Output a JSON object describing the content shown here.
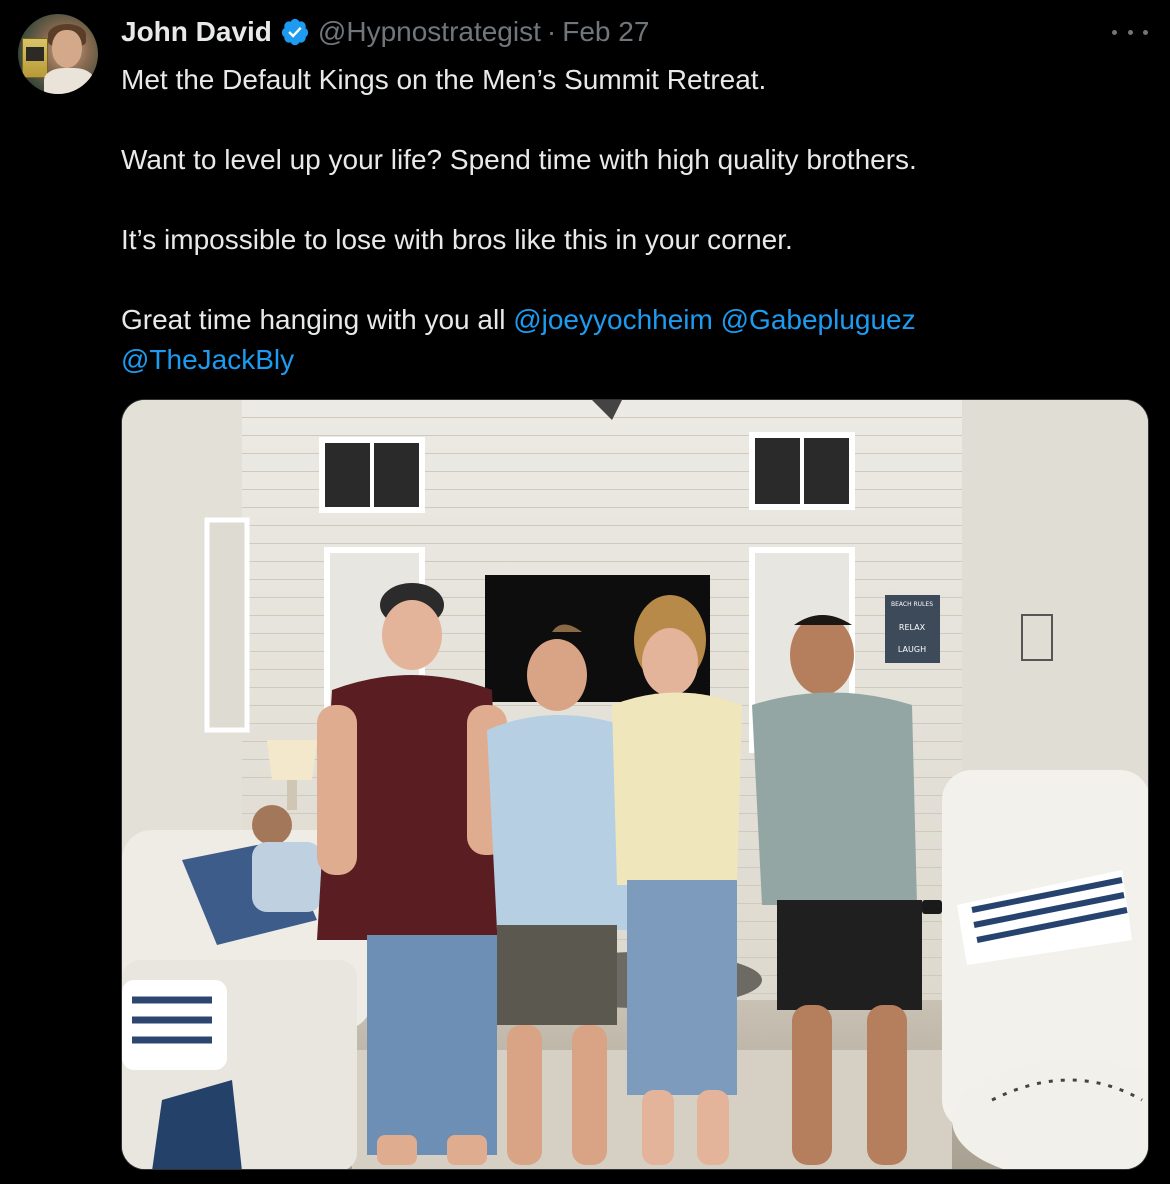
{
  "tweet": {
    "author_name": "John David",
    "author_handle": "@Hypnostrategist",
    "separator": "·",
    "date": "Feb 27",
    "lines": [
      "Met the Default Kings on the Men’s Summit Retreat.",
      "Want to level up your life? Spend time with high quality brothers.",
      "It’s impossible to lose with bros like this in your corner.",
      "Great time hanging with you all"
    ],
    "mentions": [
      "@joeyyochheim",
      "@Gabepluguez",
      "@TheJackBly"
    ]
  },
  "photo_sign": {
    "lines": [
      "BEACH RULES",
      "WATCH THE SUNRISE",
      "LISTEN TO THE WAVES",
      "SWIM & PLAY",
      "SMELL THE SALTY AIR",
      "RELAX",
      "BE HAPPY",
      "SOAK UP THE SUN",
      "BUILD SAND CASTLES",
      "LAUGH",
      "ALL DAY",
      "COLLECT SHELLS"
    ]
  },
  "icons": {
    "verified": "verified-badge-icon",
    "more": "more-options-icon"
  },
  "colors": {
    "background": "#000000",
    "text": "#e7e9ea",
    "muted": "#71767b",
    "link": "#1d9bf0",
    "verified": "#1d9bf0"
  }
}
